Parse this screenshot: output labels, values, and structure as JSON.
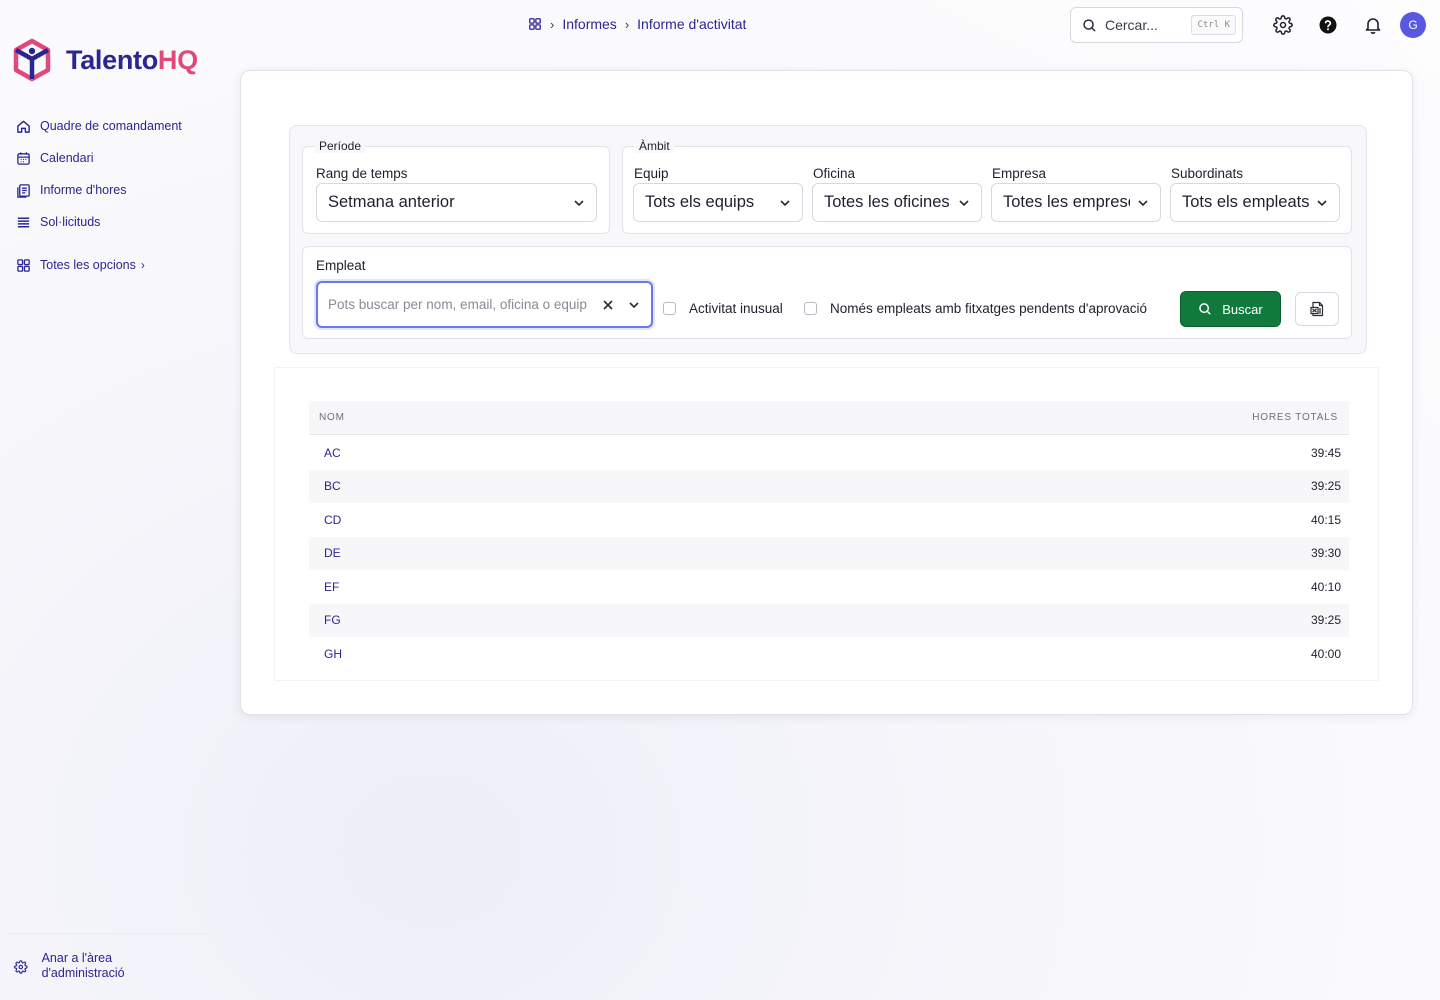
{
  "brand": {
    "name_part1": "Talento",
    "name_part2": "HQ",
    "primary_color": "#2b2592",
    "accent_color": "#e2497a"
  },
  "sidebar": {
    "items": [
      {
        "label": "Quadre de comandament",
        "icon": "home-icon"
      },
      {
        "label": "Calendari",
        "icon": "calendar-icon"
      },
      {
        "label": "Informe d'hores",
        "icon": "report-icon"
      },
      {
        "label": "Sol·licituds",
        "icon": "list-icon"
      }
    ],
    "more_label": "Totes les opcions",
    "admin_label": "Anar a l'àrea d'administració"
  },
  "header": {
    "breadcrumb": [
      "Informes",
      "Informe d'activitat"
    ],
    "search_placeholder": "Cercar...",
    "search_shortcut": "Ctrl K",
    "avatar_initial": "G"
  },
  "filters": {
    "period": {
      "legend": "Període",
      "label": "Rang de temps",
      "value": "Setmana anterior"
    },
    "scope": {
      "legend": "Àmbit",
      "team_label": "Equip",
      "team_value": "Tots els equips",
      "office_label": "Oficina",
      "office_value": "Totes les oficines",
      "company_label": "Empresa",
      "company_value": "Totes les empreses",
      "subordinates_label": "Subordinats",
      "subordinates_value": "Tots els empleats"
    },
    "employee": {
      "label": "Empleat",
      "placeholder": "Pots buscar per nom, email, oficina o equip",
      "unusual_label": "Activitat inusual",
      "pending_label": "Només empleats amb fitxatges pendents d'aprovació",
      "search_button": "Buscar",
      "search_button_color": "#0f7a3b"
    }
  },
  "table": {
    "col_name": "NOM",
    "col_hours": "HORES TOTALS",
    "rows": [
      {
        "name": "AC",
        "hours": "39:45"
      },
      {
        "name": "BC",
        "hours": "39:25"
      },
      {
        "name": "CD",
        "hours": "40:15"
      },
      {
        "name": "DE",
        "hours": "39:30"
      },
      {
        "name": "EF",
        "hours": "40:10"
      },
      {
        "name": "FG",
        "hours": "39:25"
      },
      {
        "name": "GH",
        "hours": "40:00"
      }
    ]
  }
}
